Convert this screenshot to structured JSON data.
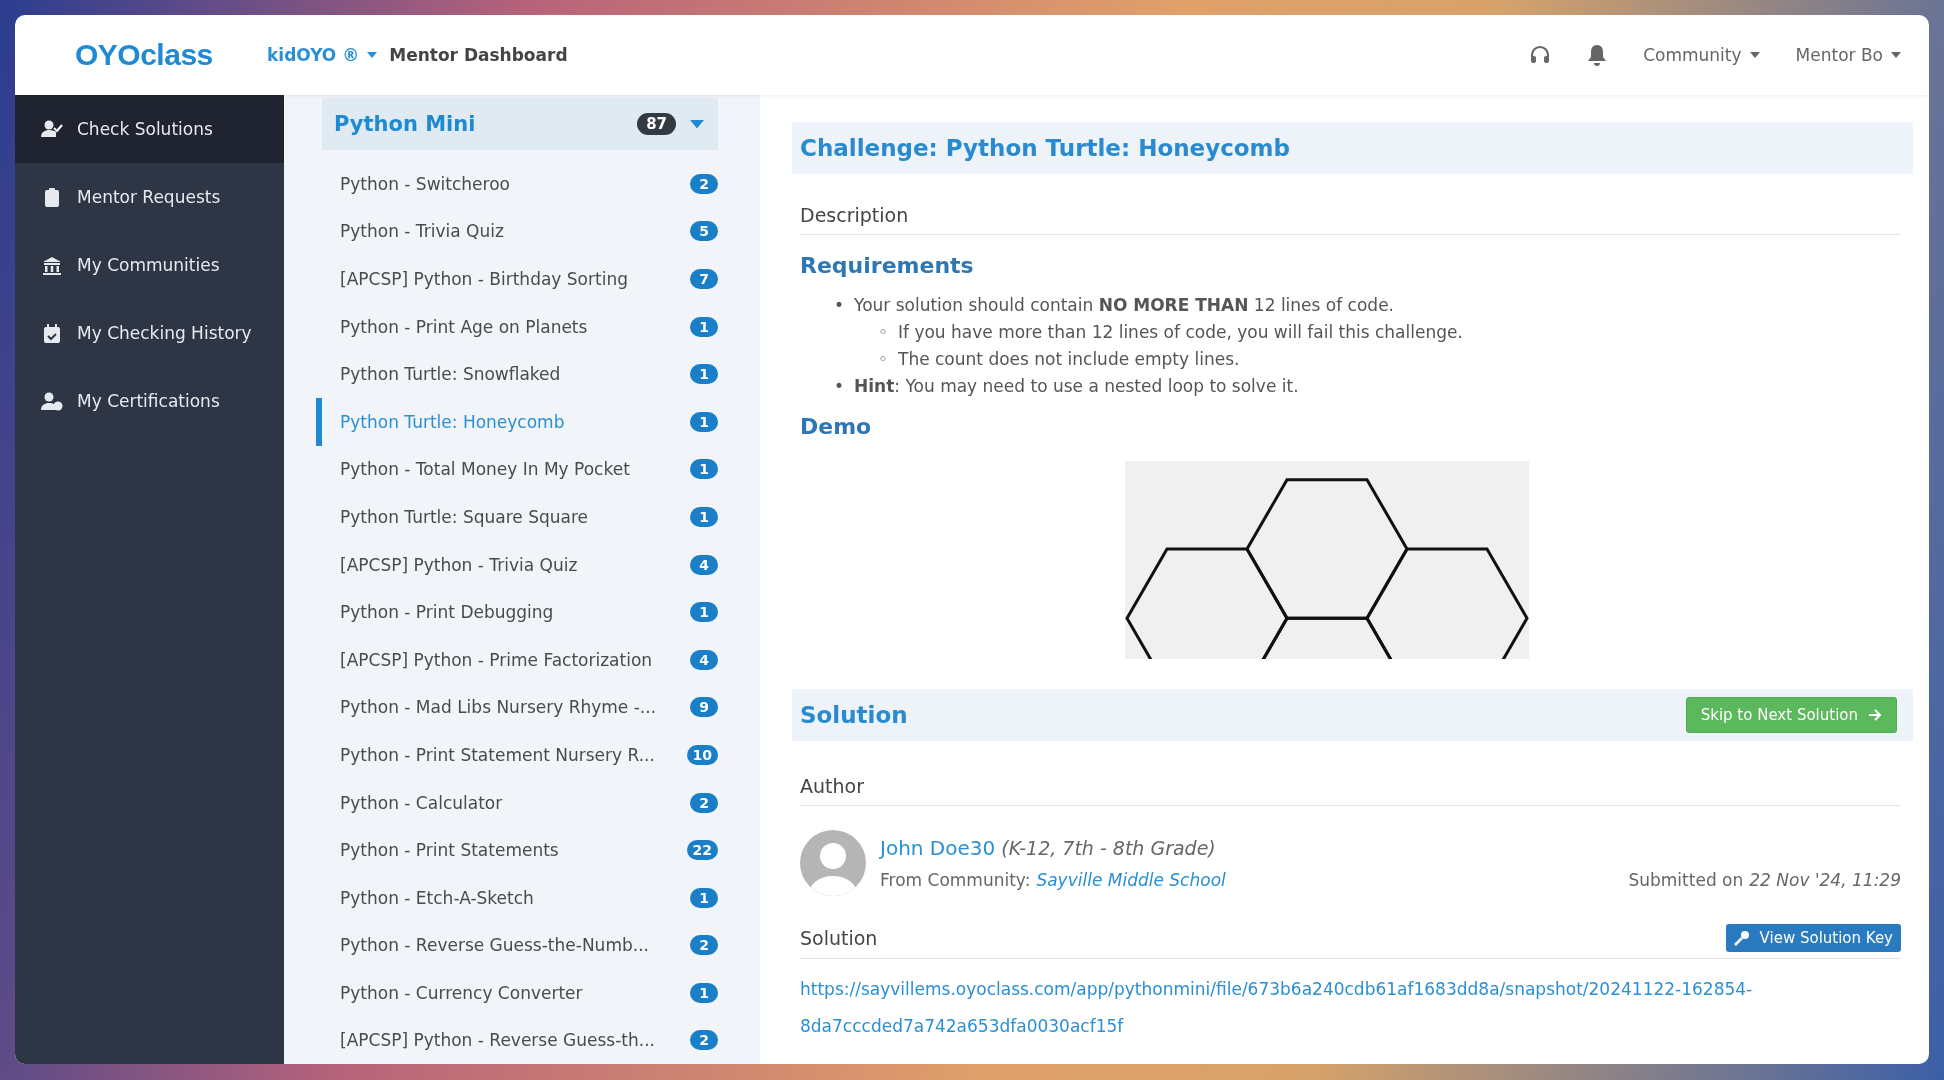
{
  "header": {
    "logo": "OYOclass",
    "product": "kidOYO ®",
    "page_title": "Mentor Dashboard",
    "menus": [
      "Community",
      "Mentor Bo"
    ]
  },
  "sidebar": {
    "items": [
      {
        "label": "Check Solutions",
        "kind": "check",
        "selected": true
      },
      {
        "label": "Mentor Requests",
        "kind": "clipboard",
        "selected": false
      },
      {
        "label": "My Communities",
        "kind": "bank",
        "selected": false
      },
      {
        "label": "My Checking History",
        "kind": "calendar",
        "selected": false
      },
      {
        "label": "My Certifications",
        "kind": "certificate",
        "selected": false
      }
    ]
  },
  "course": {
    "title": "Python Mini",
    "count": "87",
    "items": [
      {
        "label": "Python - Switcheroo",
        "count": "2",
        "selected": false
      },
      {
        "label": "Python - Trivia Quiz",
        "count": "5",
        "selected": false
      },
      {
        "label": "[APCSP] Python - Birthday Sorting",
        "count": "7",
        "selected": false
      },
      {
        "label": "Python - Print Age on Planets",
        "count": "1",
        "selected": false
      },
      {
        "label": "Python Turtle: Snowflaked",
        "count": "1",
        "selected": false
      },
      {
        "label": "Python Turtle: Honeycomb",
        "count": "1",
        "selected": true
      },
      {
        "label": "Python - Total Money In My Pocket",
        "count": "1",
        "selected": false
      },
      {
        "label": "Python Turtle: Square Square",
        "count": "1",
        "selected": false
      },
      {
        "label": "[APCSP] Python - Trivia Quiz",
        "count": "4",
        "selected": false
      },
      {
        "label": "Python - Print Debugging",
        "count": "1",
        "selected": false
      },
      {
        "label": "[APCSP] Python - Prime Factorization",
        "count": "4",
        "selected": false
      },
      {
        "label": "Python - Mad Libs Nursery Rhyme -...",
        "count": "9",
        "selected": false
      },
      {
        "label": "Python - Print Statement Nursery R...",
        "count": "10",
        "selected": false
      },
      {
        "label": "Python - Calculator",
        "count": "2",
        "selected": false
      },
      {
        "label": "Python - Print Statements",
        "count": "22",
        "selected": false
      },
      {
        "label": "Python - Etch-A-Sketch",
        "count": "1",
        "selected": false
      },
      {
        "label": "Python - Reverse Guess-the-Numb...",
        "count": "2",
        "selected": false
      },
      {
        "label": "Python - Currency Converter",
        "count": "1",
        "selected": false
      },
      {
        "label": "[APCSP] Python - Reverse Guess-th...",
        "count": "2",
        "selected": false
      }
    ]
  },
  "challenge": {
    "title": "Challenge: Python Turtle: Honeycomb",
    "description_heading": "Description",
    "requirements_heading": "Requirements",
    "requirements": [
      {
        "marker": "•",
        "text": "Your solution should contain **NO MORE THAN** 12 lines of code.",
        "children": [
          {
            "marker": "◦",
            "text": "If you have more than 12 lines of code, you will fail this challenge."
          },
          {
            "marker": "◦",
            "text": "The count does not include empty lines."
          }
        ]
      },
      {
        "marker": "•",
        "text": "**Hint**: You may need to use a nested loop to solve it."
      }
    ],
    "demo_heading": "Demo"
  },
  "solution": {
    "heading": "Solution",
    "skip_button": "Skip to Next Solution",
    "author_heading": "Author",
    "author_name": "John Doe30",
    "author_grade": "(K-12, 7th - 8th Grade)",
    "community_label": "From Community:",
    "community": "Sayville Middle School",
    "submitted_label": "Submitted on",
    "submitted_at": "22 Nov '24, 11:29",
    "solution_heading": "Solution",
    "key_button": "View Solution Key",
    "link": "https://sayvillems.oyoclass.com/app/pythonmini/file/673b6a240cdb61af1683dd8a/snapshot/20241122-162854-8da7cccded7a742a653dfa0030acf15f"
  }
}
